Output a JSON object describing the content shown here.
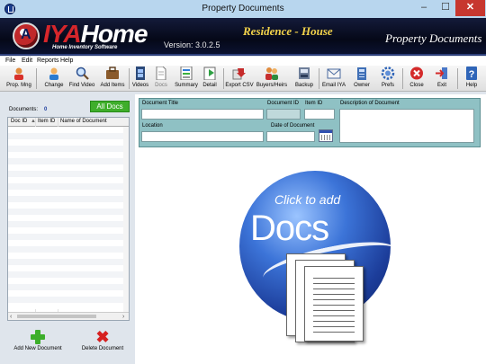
{
  "window": {
    "title": "Property Documents"
  },
  "banner": {
    "logo_main": "IYAHome",
    "logo_sub": "Home Inventory Software",
    "version": "Version: 3.0.2.5",
    "property": "Residence - House",
    "screen_title": "Property Documents"
  },
  "menu": [
    "File",
    "Edit",
    "Reports",
    "Help"
  ],
  "toolbar": [
    {
      "label": "Prop. Mng",
      "icon": "home-user-icon"
    },
    {
      "label": "Change",
      "icon": "user-change-icon"
    },
    {
      "label": "Find Video",
      "icon": "magnifier-icon"
    },
    {
      "label": "Add Items",
      "icon": "briefcase-icon"
    },
    {
      "label": "Videos",
      "icon": "film-icon"
    },
    {
      "label": "Docs",
      "icon": "document-icon"
    },
    {
      "label": "Summary",
      "icon": "summary-icon"
    },
    {
      "label": "Detail",
      "icon": "detail-icon"
    },
    {
      "label": "Export CSV",
      "icon": "export-icon"
    },
    {
      "label": "Buyers/Heirs",
      "icon": "people-icon"
    },
    {
      "label": "Backup",
      "icon": "backup-icon"
    },
    {
      "label": "Email IYA",
      "icon": "email-icon"
    },
    {
      "label": "Owner",
      "icon": "owner-icon"
    },
    {
      "label": "Prefs",
      "icon": "gear-icon"
    },
    {
      "label": "Close",
      "icon": "close-icon"
    },
    {
      "label": "Exit",
      "icon": "exit-icon"
    },
    {
      "label": "Help",
      "icon": "help-icon"
    }
  ],
  "documents": {
    "count_label": "Documents:",
    "count": "0",
    "all_docs_label": "All Docs",
    "columns": [
      "Doc ID",
      "Item ID",
      "Name of Document"
    ],
    "add_label": "Add New Document",
    "delete_label": "Delete Document"
  },
  "details": {
    "doc_title_label": "Document Title",
    "doc_id_label": "Document ID",
    "item_id_label": "Item ID",
    "description_label": "Description of Document",
    "location_label": "Location",
    "date_label": "Date of Document"
  },
  "hero": {
    "caption": "Click to add",
    "big": "Docs"
  }
}
